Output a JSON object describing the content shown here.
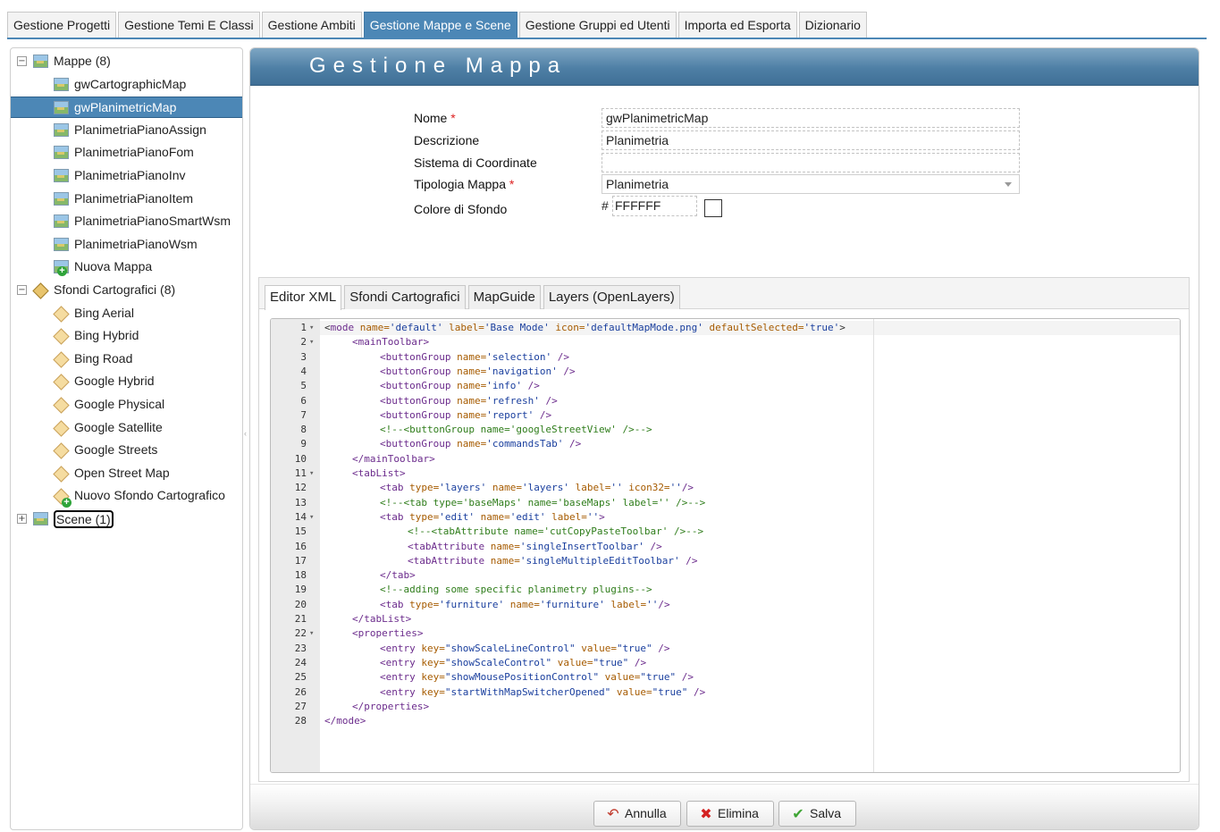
{
  "top_tabs": [
    {
      "label": "Gestione Progetti"
    },
    {
      "label": "Gestione Temi E Classi"
    },
    {
      "label": "Gestione Ambiti"
    },
    {
      "label": "Gestione Mappe e Scene",
      "active": true
    },
    {
      "label": "Gestione Gruppi ed Utenti"
    },
    {
      "label": "Importa ed Esporta"
    },
    {
      "label": "Dizionario"
    }
  ],
  "tree": {
    "mappe": {
      "label": "Mappe (8)",
      "items": [
        "gwCartographicMap",
        "gwPlanimetricMap",
        "PlanimetriaPianoAssign",
        "PlanimetriaPianoFom",
        "PlanimetriaPianoInv",
        "PlanimetriaPianoItem",
        "PlanimetriaPianoSmartWsm",
        "PlanimetriaPianoWsm"
      ],
      "selected": "gwPlanimetricMap",
      "new_label": "Nuova Mappa"
    },
    "sfondi": {
      "label": "Sfondi Cartografici (8)",
      "items": [
        "Bing Aerial",
        "Bing Hybrid",
        "Bing Road",
        "Google Hybrid",
        "Google Physical",
        "Google Satellite",
        "Google Streets",
        "Open Street Map"
      ],
      "new_label": "Nuovo Sfondo Cartografico"
    },
    "scene": {
      "label": "Scene (1)"
    }
  },
  "panel": {
    "title": "Gestione Mappa",
    "form": {
      "nome": {
        "label": "Nome",
        "value": "gwPlanimetricMap",
        "required_mark": "*"
      },
      "descrizione": {
        "label": "Descrizione",
        "value": "Planimetria"
      },
      "sistema": {
        "label": "Sistema di Coordinate",
        "value": ""
      },
      "tipologia": {
        "label": "Tipologia Mappa",
        "value": "Planimetria",
        "required_mark": "*"
      },
      "colore": {
        "label": "Colore di Sfondo",
        "hash": "#",
        "value": "FFFFFF",
        "swatch": "#FFFFFF"
      }
    },
    "editor_tabs": [
      {
        "label": "Editor XML",
        "active": true
      },
      {
        "label": "Sfondi Cartografici"
      },
      {
        "label": "MapGuide"
      },
      {
        "label": "Layers (OpenLayers)"
      }
    ],
    "code_lines": [
      {
        "n": "1",
        "fold": true,
        "indent": 0,
        "parts": [
          [
            "t-brk",
            "<"
          ],
          [
            "t-tag",
            "mode"
          ],
          [
            "t-attr",
            " name="
          ],
          [
            "t-str",
            "'default'"
          ],
          [
            "t-attr",
            " label="
          ],
          [
            "t-str",
            "'Base Mode'"
          ],
          [
            "t-attr",
            " icon="
          ],
          [
            "t-str",
            "'defaultMapMode.png'"
          ],
          [
            "t-attr",
            " defaultSelected="
          ],
          [
            "t-str",
            "'true'"
          ],
          [
            "t-brk",
            ">"
          ]
        ]
      },
      {
        "n": "2",
        "fold": true,
        "indent": 1,
        "parts": [
          [
            "t-tag",
            "<mainToolbar>"
          ]
        ]
      },
      {
        "n": "3",
        "indent": 2,
        "parts": [
          [
            "t-tag",
            "<buttonGroup"
          ],
          [
            "t-attr",
            " name="
          ],
          [
            "t-str",
            "'selection'"
          ],
          [
            "t-tag",
            " />"
          ]
        ]
      },
      {
        "n": "4",
        "indent": 2,
        "parts": [
          [
            "t-tag",
            "<buttonGroup"
          ],
          [
            "t-attr",
            " name="
          ],
          [
            "t-str",
            "'navigation'"
          ],
          [
            "t-tag",
            " />"
          ]
        ]
      },
      {
        "n": "5",
        "indent": 2,
        "parts": [
          [
            "t-tag",
            "<buttonGroup"
          ],
          [
            "t-attr",
            " name="
          ],
          [
            "t-str",
            "'info'"
          ],
          [
            "t-tag",
            " />"
          ]
        ]
      },
      {
        "n": "6",
        "indent": 2,
        "parts": [
          [
            "t-tag",
            "<buttonGroup"
          ],
          [
            "t-attr",
            " name="
          ],
          [
            "t-str",
            "'refresh'"
          ],
          [
            "t-tag",
            " />"
          ]
        ]
      },
      {
        "n": "7",
        "indent": 2,
        "parts": [
          [
            "t-tag",
            "<buttonGroup"
          ],
          [
            "t-attr",
            " name="
          ],
          [
            "t-str",
            "'report'"
          ],
          [
            "t-tag",
            " />"
          ]
        ]
      },
      {
        "n": "8",
        "indent": 2,
        "parts": [
          [
            "t-com",
            "<!--<buttonGroup name='googleStreetView' />-->"
          ]
        ]
      },
      {
        "n": "9",
        "indent": 2,
        "parts": [
          [
            "t-tag",
            "<buttonGroup"
          ],
          [
            "t-attr",
            " name="
          ],
          [
            "t-str",
            "'commandsTab'"
          ],
          [
            "t-tag",
            " />"
          ]
        ]
      },
      {
        "n": "10",
        "indent": 1,
        "parts": [
          [
            "t-tag",
            "</mainToolbar>"
          ]
        ]
      },
      {
        "n": "11",
        "fold": true,
        "indent": 1,
        "parts": [
          [
            "t-tag",
            "<tabList>"
          ]
        ]
      },
      {
        "n": "12",
        "indent": 2,
        "parts": [
          [
            "t-tag",
            "<tab"
          ],
          [
            "t-attr",
            " type="
          ],
          [
            "t-str",
            "'layers'"
          ],
          [
            "t-attr",
            " name="
          ],
          [
            "t-str",
            "'layers'"
          ],
          [
            "t-attr",
            " label="
          ],
          [
            "t-str",
            "''"
          ],
          [
            "t-attr",
            " icon32="
          ],
          [
            "t-str",
            "''"
          ],
          [
            "t-tag",
            "/>"
          ]
        ]
      },
      {
        "n": "13",
        "indent": 2,
        "parts": [
          [
            "t-com",
            "<!--<tab type='baseMaps' name='baseMaps' label='' />-->"
          ]
        ]
      },
      {
        "n": "14",
        "fold": true,
        "indent": 2,
        "parts": [
          [
            "t-tag",
            "<tab"
          ],
          [
            "t-attr",
            " type="
          ],
          [
            "t-str",
            "'edit'"
          ],
          [
            "t-attr",
            " name="
          ],
          [
            "t-str",
            "'edit'"
          ],
          [
            "t-attr",
            " label="
          ],
          [
            "t-str",
            "''"
          ],
          [
            "t-tag",
            ">"
          ]
        ]
      },
      {
        "n": "15",
        "indent": 3,
        "parts": [
          [
            "t-com",
            "<!--<tabAttribute name='cutCopyPasteToolbar' />-->"
          ]
        ]
      },
      {
        "n": "16",
        "indent": 3,
        "parts": [
          [
            "t-tag",
            "<tabAttribute"
          ],
          [
            "t-attr",
            " name="
          ],
          [
            "t-str",
            "'singleInsertToolbar'"
          ],
          [
            "t-tag",
            " />"
          ]
        ]
      },
      {
        "n": "17",
        "indent": 3,
        "parts": [
          [
            "t-tag",
            "<tabAttribute"
          ],
          [
            "t-attr",
            " name="
          ],
          [
            "t-str",
            "'singleMultipleEditToolbar'"
          ],
          [
            "t-tag",
            " />"
          ]
        ]
      },
      {
        "n": "18",
        "indent": 2,
        "parts": [
          [
            "t-tag",
            "</tab>"
          ]
        ]
      },
      {
        "n": "19",
        "indent": 2,
        "parts": [
          [
            "t-com",
            "<!--adding some specific planimetry plugins-->"
          ]
        ]
      },
      {
        "n": "20",
        "indent": 2,
        "parts": [
          [
            "t-tag",
            "<tab"
          ],
          [
            "t-attr",
            " type="
          ],
          [
            "t-str",
            "'furniture'"
          ],
          [
            "t-attr",
            " name="
          ],
          [
            "t-str",
            "'furniture'"
          ],
          [
            "t-attr",
            " label="
          ],
          [
            "t-str",
            "''"
          ],
          [
            "t-tag",
            "/>"
          ]
        ]
      },
      {
        "n": "21",
        "indent": 1,
        "parts": [
          [
            "t-tag",
            "</tabList>"
          ]
        ]
      },
      {
        "n": "22",
        "fold": true,
        "indent": 1,
        "parts": [
          [
            "t-tag",
            "<properties>"
          ]
        ]
      },
      {
        "n": "23",
        "indent": 2,
        "parts": [
          [
            "t-tag",
            "<entry"
          ],
          [
            "t-attr",
            " key="
          ],
          [
            "t-str",
            "\"showScaleLineControl\""
          ],
          [
            "t-attr",
            " value="
          ],
          [
            "t-str",
            "\"true\""
          ],
          [
            "t-tag",
            " />"
          ]
        ]
      },
      {
        "n": "24",
        "indent": 2,
        "parts": [
          [
            "t-tag",
            "<entry"
          ],
          [
            "t-attr",
            " key="
          ],
          [
            "t-str",
            "\"showScaleControl\""
          ],
          [
            "t-attr",
            " value="
          ],
          [
            "t-str",
            "\"true\""
          ],
          [
            "t-tag",
            " />"
          ]
        ]
      },
      {
        "n": "25",
        "indent": 2,
        "parts": [
          [
            "t-tag",
            "<entry"
          ],
          [
            "t-attr",
            " key="
          ],
          [
            "t-str",
            "\"showMousePositionControl\""
          ],
          [
            "t-attr",
            " value="
          ],
          [
            "t-str",
            "\"true\""
          ],
          [
            "t-tag",
            " />"
          ]
        ]
      },
      {
        "n": "26",
        "indent": 2,
        "parts": [
          [
            "t-tag",
            "<entry"
          ],
          [
            "t-attr",
            " key="
          ],
          [
            "t-str",
            "\"startWithMapSwitcherOpened\""
          ],
          [
            "t-attr",
            " value="
          ],
          [
            "t-str",
            "\"true\""
          ],
          [
            "t-tag",
            " />"
          ]
        ]
      },
      {
        "n": "27",
        "indent": 1,
        "parts": [
          [
            "t-tag",
            "</properties>"
          ]
        ]
      },
      {
        "n": "28",
        "indent": 0,
        "parts": [
          [
            "t-tag",
            "</mode>"
          ]
        ]
      }
    ],
    "buttons": {
      "annulla": {
        "label": "Annulla",
        "icon": "undo-icon",
        "color": "#c0392b"
      },
      "elimina": {
        "label": "Elimina",
        "icon": "delete-icon",
        "color": "#d42020"
      },
      "salva": {
        "label": "Salva",
        "icon": "check-icon",
        "color": "#3fa535"
      }
    }
  },
  "colors": {
    "accent": "#4c87b6",
    "header": "#4e7fa5"
  }
}
